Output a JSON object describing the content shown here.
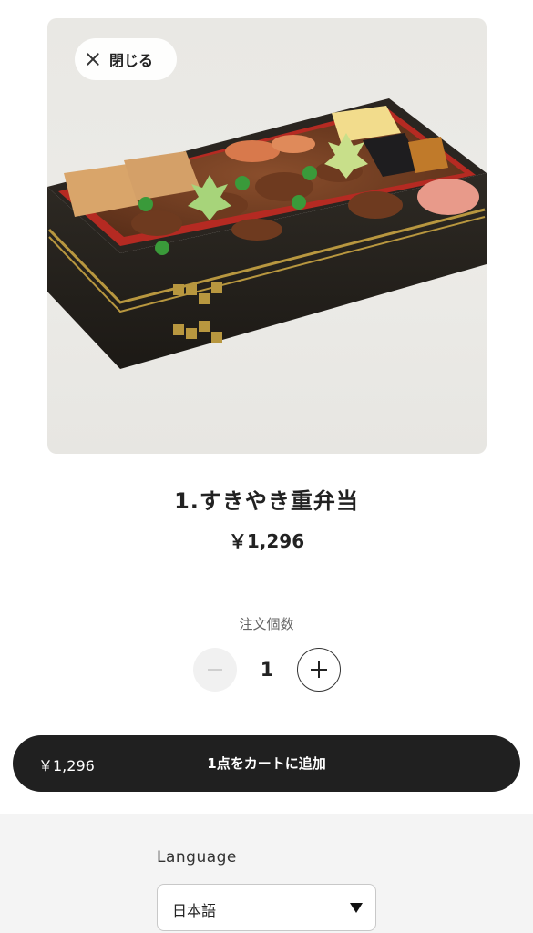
{
  "header": {
    "close_label": "閉じる"
  },
  "product": {
    "image_icon": "bento-box-image",
    "name": "1.すきやき重弁当",
    "price": "￥1,296"
  },
  "quantity": {
    "label": "注文個数",
    "value": "1",
    "decrement_icon": "minus-icon",
    "increment_icon": "plus-icon"
  },
  "cart_button": {
    "price": "￥1,296",
    "label": "1点をカートに追加"
  },
  "footer": {
    "language_label": "Language",
    "language_value": "日本語"
  },
  "colors": {
    "cart_button_bg": "#202020",
    "footer_bg": "#f4f4f4"
  }
}
